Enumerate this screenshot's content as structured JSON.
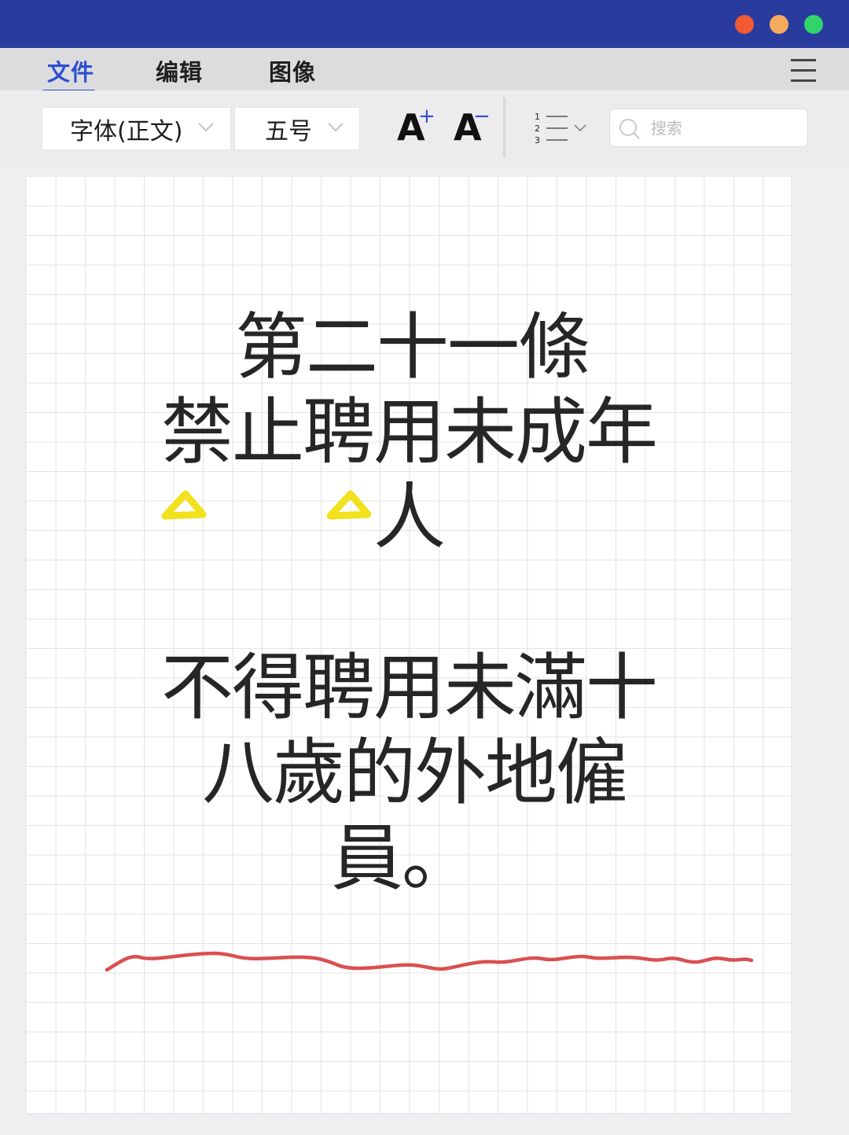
{
  "window": {
    "controls": {
      "close_color": "#f25a33",
      "minimize_color": "#f5ab5e",
      "zoom_color": "#33d36b"
    },
    "titlebar_color": "#2a3b9e"
  },
  "menu": {
    "items": [
      {
        "label": "文件",
        "active": true
      },
      {
        "label": "编辑",
        "active": false
      },
      {
        "label": "图像",
        "active": false
      }
    ],
    "accent_color": "#2d4fd0",
    "more_icon": "hamburger-menu-icon"
  },
  "toolbar": {
    "font_family_value": "字体(正文)",
    "font_size_value": "五号",
    "grow_font_label": "A",
    "grow_font_symbol": "+",
    "shrink_font_label": "A",
    "shrink_font_symbol": "−",
    "list_numbers": [
      "1",
      "2",
      "3"
    ],
    "search_placeholder": "搜索"
  },
  "document": {
    "lines": [
      "第二十一條",
      "禁止聘用未成年",
      "人",
      "不得聘用未滿十",
      "八歲的外地僱",
      "員。"
    ],
    "text_color": "#262626",
    "highlight_marks_color": "#f2e11d",
    "underline_stroke_color": "#d9504f"
  }
}
